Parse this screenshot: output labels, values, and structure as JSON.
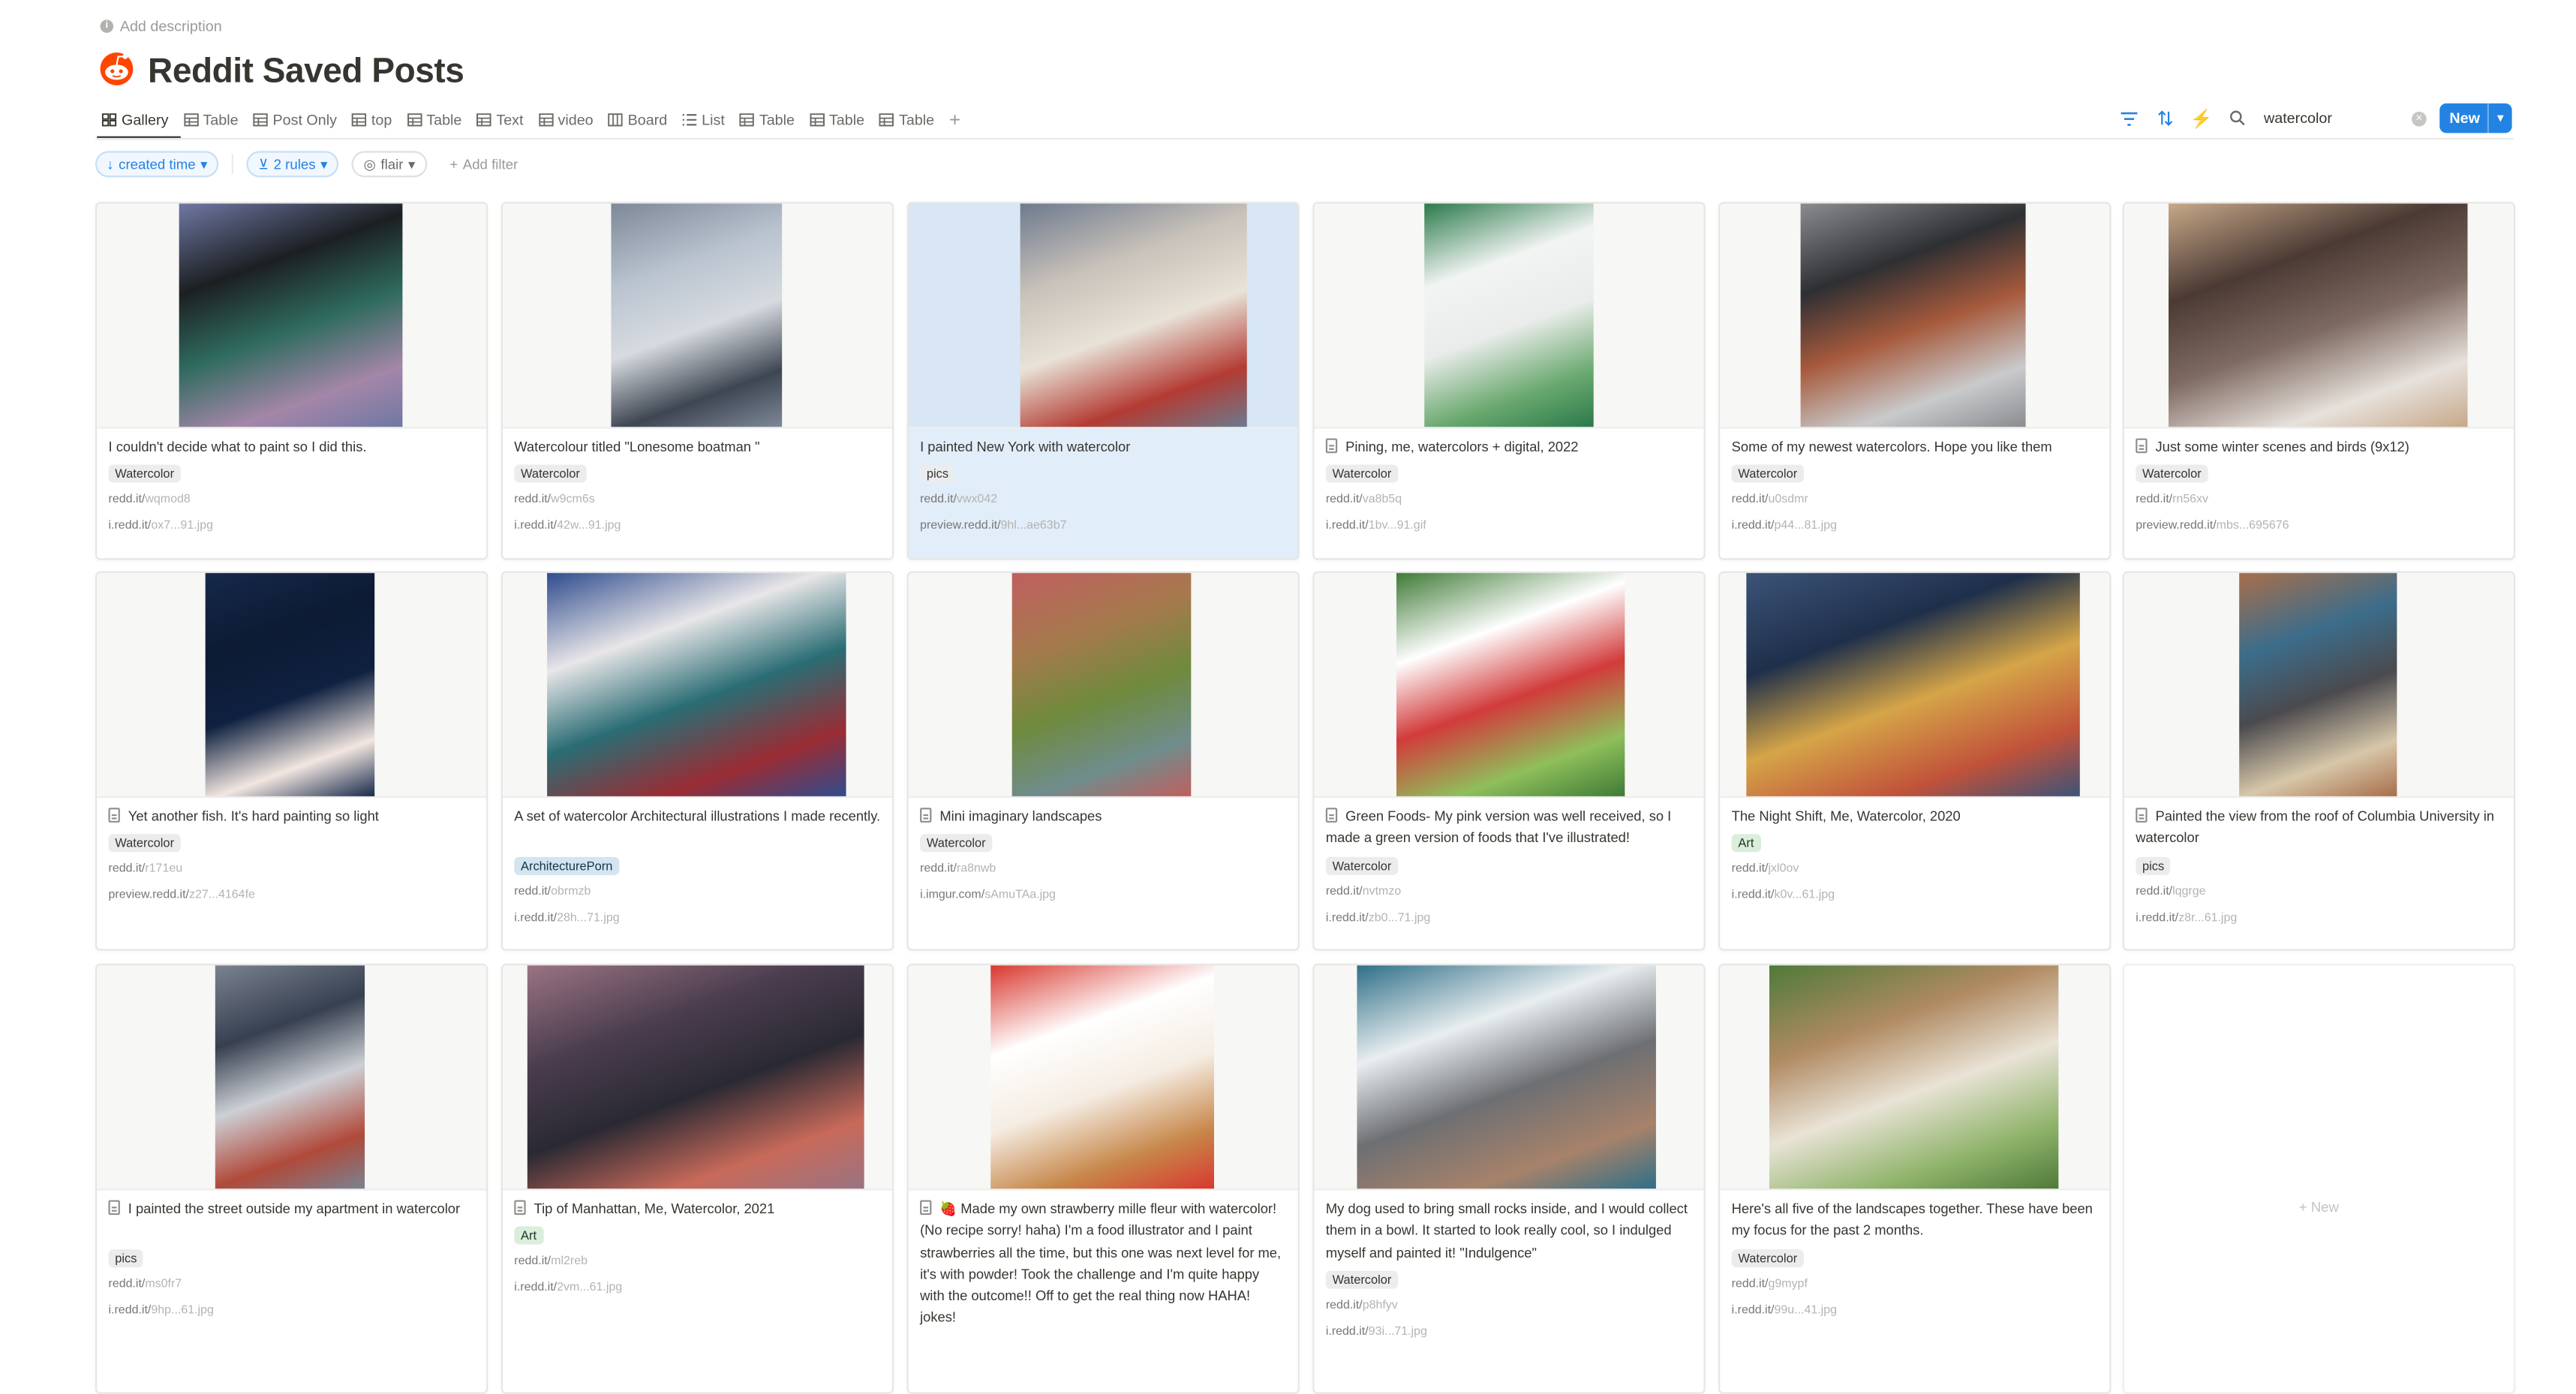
{
  "page": {
    "add_description": "Add description",
    "title": "Reddit Saved Posts",
    "colors": {
      "accent": "#2383e2",
      "logo": "#ff4500"
    }
  },
  "tabs": [
    {
      "label": "Gallery",
      "icon": "gallery-icon",
      "active": true
    },
    {
      "label": "Table",
      "icon": "table-icon"
    },
    {
      "label": "Post Only",
      "icon": "table-icon"
    },
    {
      "label": "top",
      "icon": "table-icon"
    },
    {
      "label": "Table",
      "icon": "table-icon"
    },
    {
      "label": "Text",
      "icon": "table-icon"
    },
    {
      "label": "video",
      "icon": "table-icon"
    },
    {
      "label": "Board",
      "icon": "board-icon"
    },
    {
      "label": "List",
      "icon": "list-icon"
    },
    {
      "label": "Table",
      "icon": "table-icon"
    },
    {
      "label": "Table",
      "icon": "table-icon"
    },
    {
      "label": "Table",
      "icon": "table-icon"
    }
  ],
  "toolbar": {
    "search_value": "watercolor",
    "new_label": "New"
  },
  "filters": {
    "sort_label": "created time",
    "rules_label": "2 rules",
    "flair_label": "flair",
    "add_filter": "Add filter"
  },
  "cards": [
    {
      "title": "I couldn't decide what to paint so I did this.",
      "doc": false,
      "tag": "Watercolor",
      "url1": "redd.it/",
      "url1_rest": "wqmod8",
      "url2": "i.redd.it/",
      "url2_rest": "ox7...91.jpg",
      "palette": [
        "#1c1f22",
        "#6f78a4",
        "#a486a8",
        "#2f6b5e"
      ]
    },
    {
      "title": "Watercolour titled \"Lonesome boatman \"",
      "doc": false,
      "tag": "Watercolor",
      "url1": "redd.it/",
      "url1_rest": "w9cm6s",
      "url2": "i.redd.it/",
      "url2_rest": "42w...91.jpg",
      "palette": [
        "#b9c3cf",
        "#7d8898",
        "#3e4652",
        "#d7dbe0"
      ]
    },
    {
      "title": "I painted New York with watercolor",
      "doc": false,
      "tag": "pics",
      "url1": "redd.it/",
      "url1_rest": "vwx042",
      "url2": "preview.redd.it/",
      "url2_rest": "9hl...ae63b7",
      "palette": [
        "#c9c2ba",
        "#6d7a8e",
        "#b33b33",
        "#e8e2d7"
      ],
      "selected": true
    },
    {
      "title": "Pining, me, watercolors + digital, 2022",
      "doc": true,
      "tag": "Watercolor",
      "url1": "redd.it/",
      "url1_rest": "va8b5q",
      "url2": "i.redd.it/",
      "url2_rest": "1bv...91.gif",
      "palette": [
        "#f2f4f3",
        "#2b7a4b",
        "#6aa96f",
        "#e9ecea"
      ]
    },
    {
      "title": "Some of my newest watercolors. Hope you like them",
      "doc": false,
      "tag": "Watercolor",
      "url1": "redd.it/",
      "url1_rest": "u0sdmr",
      "url2": "i.redd.it/",
      "url2_rest": "p44...81.jpg",
      "palette": [
        "#2e2f33",
        "#8a8c90",
        "#c9cacc",
        "#a65a3c"
      ]
    },
    {
      "title": "Just some winter scenes and birds (9x12)",
      "doc": true,
      "tag": "Watercolor",
      "url1": "redd.it/",
      "url1_rest": "rn56xv",
      "url2": "preview.redd.it/",
      "url2_rest": "mbs...695676",
      "palette": [
        "#4b3a34",
        "#c7a889",
        "#e7e1dc",
        "#7e6a60"
      ]
    },
    {
      "title": "Yet another fish. It's hard painting so light",
      "doc": true,
      "tag": "Watercolor",
      "url1": "redd.it/",
      "url1_rest": "r171eu",
      "url2": "preview.redd.it/",
      "url2_rest": "z27...4164fe",
      "palette": [
        "#0c1a33",
        "#16294a",
        "#f2e6e0",
        "#0f2140"
      ]
    },
    {
      "title": "A set of watercolor Architectural illustrations I made recently.",
      "doc": false,
      "tag": "ArchitecturePorn",
      "url1": "redd.it/",
      "url1_rest": "obrmzb",
      "url2": "i.redd.it/",
      "url2_rest": "28h...71.jpg",
      "palette": [
        "#e8e6e8",
        "#2f4c8e",
        "#9a2c34",
        "#2a6d74"
      ]
    },
    {
      "title": "Mini imaginary landscapes",
      "doc": true,
      "tag": "Watercolor",
      "url1": "redd.it/",
      "url1_rest": "ra8nwb",
      "url2": "i.imgur.com/",
      "url2_rest": "sAmuTAa.jpg",
      "palette": [
        "#a57a4d",
        "#c05f5f",
        "#6f8d8c",
        "#6f8a3c"
      ]
    },
    {
      "title": "Green Foods- My pink version was well received, so I made a green version of foods that I've illustrated!",
      "doc": true,
      "tag": "Watercolor",
      "url1": "redd.it/",
      "url1_rest": "nvtmzo",
      "url2": "i.redd.it/",
      "url2_rest": "zb0...71.jpg",
      "palette": [
        "#ffffff",
        "#3f7a36",
        "#8fbf5b",
        "#d23b3b"
      ]
    },
    {
      "title": "The Night Shift, Me, Watercolor, 2020",
      "doc": false,
      "tag": "Art",
      "url1": "redd.it/",
      "url1_rest": "jxl0ov",
      "url2": "i.redd.it/",
      "url2_rest": "k0v...61.jpg",
      "palette": [
        "#1e2f4a",
        "#3c5378",
        "#c1523a",
        "#d5a548"
      ]
    },
    {
      "title": "Painted the view from the roof of Columbia University in watercolor",
      "doc": true,
      "tag": "pics",
      "url1": "redd.it/",
      "url1_rest": "lqgrge",
      "url2": "i.redd.it/",
      "url2_rest": "z8r...61.jpg",
      "palette": [
        "#3c6d8b",
        "#a86e4b",
        "#d7c7a9",
        "#4b4a4e"
      ]
    },
    {
      "title": "I painted the street outside my apartment in watercolor",
      "doc": true,
      "tag": "pics",
      "url1": "redd.it/",
      "url1_rest": "ms0fr7",
      "url2": "i.redd.it/",
      "url2_rest": "9hp...61.jpg",
      "palette": [
        "#374050",
        "#7a8291",
        "#b04a3a",
        "#cdd0d6"
      ]
    },
    {
      "title": "Tip of Manhattan, Me, Watercolor, 2021",
      "doc": true,
      "tag": "Art",
      "url1": "redd.it/",
      "url1_rest": "ml2reb",
      "url2": "i.redd.it/",
      "url2_rest": "2vm...61.jpg",
      "palette": [
        "#4a3d4e",
        "#9a7382",
        "#c86a5a",
        "#2a2933"
      ]
    },
    {
      "title": "🍓 Made my own strawberry mille fleur with watercolor! (No recipe sorry! haha) I'm a food illustrator and I paint strawberries all the time, but this one was next level for me, it's with powder! Took the challenge and I'm quite happy with the outcome!! Off to get the real thing now HAHA! jokes!",
      "doc": true,
      "tag": "",
      "url1": "",
      "url1_rest": "",
      "url2": "",
      "url2_rest": "",
      "palette": [
        "#ffffff",
        "#d9382f",
        "#c7874a",
        "#f5ede3"
      ]
    },
    {
      "title": "My dog used to bring small rocks inside, and I would collect them in a bowl. It started to look really cool, so I indulged myself and painted it! \"Indulgence\"",
      "doc": false,
      "tag": "Watercolor",
      "url1": "redd.it/",
      "url1_rest": "p8hfyv",
      "url2": "i.redd.it/",
      "url2_rest": "93i...71.jpg",
      "palette": [
        "#e9eef0",
        "#2f6f88",
        "#a7826a",
        "#6d6f73"
      ]
    },
    {
      "title": "Here's all five of the landscapes together. These have been my focus for the past 2 months.",
      "doc": false,
      "tag": "Watercolor",
      "url1": "redd.it/",
      "url1_rest": "g9mypf",
      "url2": "i.redd.it/",
      "url2_rest": "99u...41.jpg",
      "palette": [
        "#b08a62",
        "#4f7a3a",
        "#8fb36a",
        "#e9e3d6"
      ]
    }
  ],
  "new_card_label": "New"
}
